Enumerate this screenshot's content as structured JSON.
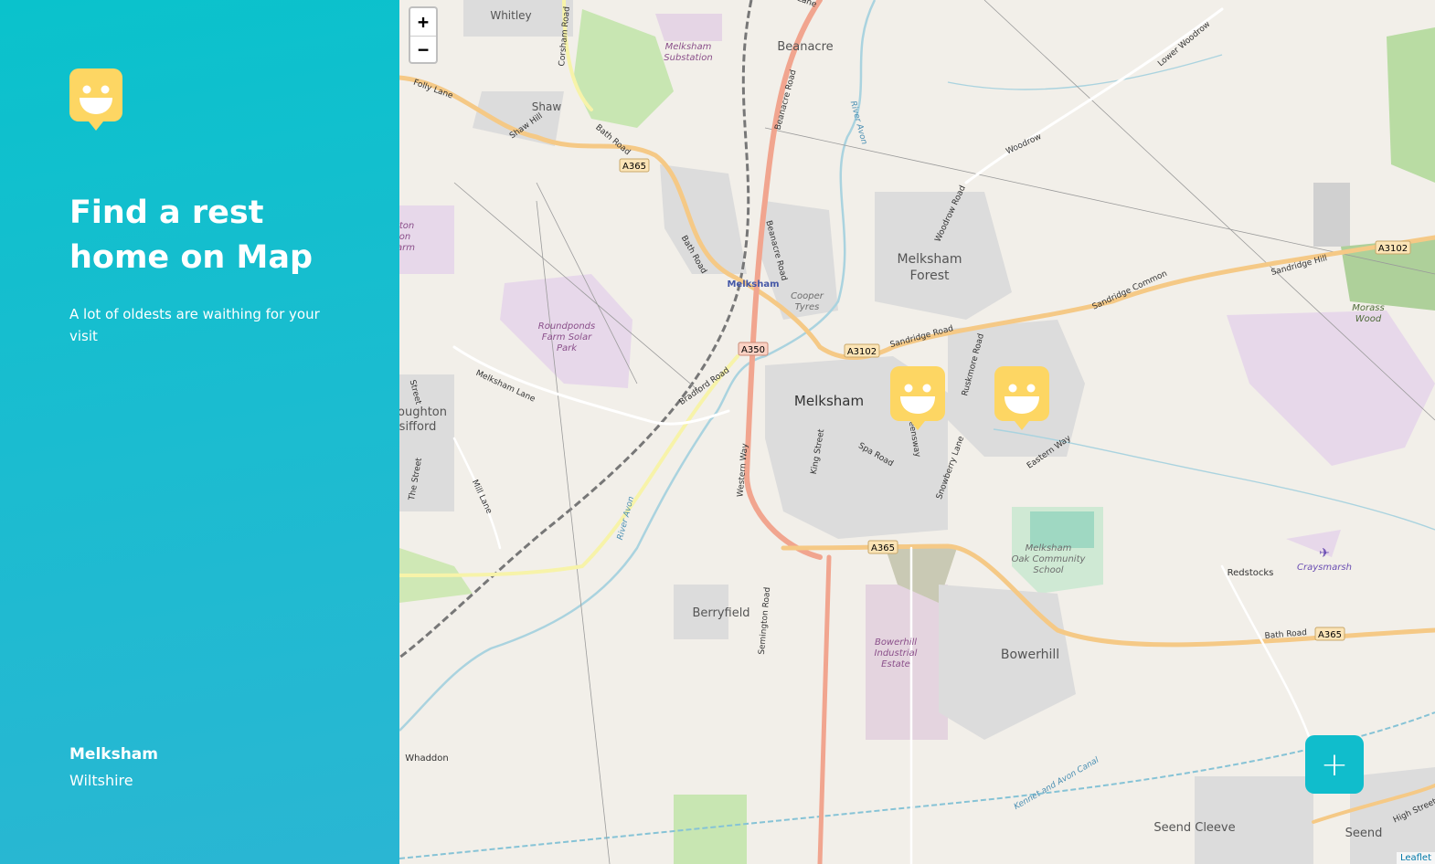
{
  "sidebar": {
    "logo_icon": "smiley-speech-bubble-icon",
    "title": "Find a rest home on Map",
    "subtitle": "A lot of oldests are waithing for your visit",
    "location": {
      "city": "Melksham",
      "region": "Wiltshire"
    }
  },
  "map": {
    "zoom_in_label": "+",
    "zoom_out_label": "−",
    "add_button_label": "+",
    "attribution": "Leaflet",
    "marker_icon": "smiley-speech-bubble-icon",
    "marker_count": 2,
    "colors": {
      "accent": "#10bdcc",
      "marker": "#fdd663",
      "sidebar_top": "#0ac2cc",
      "sidebar_bottom": "#2ab6d3"
    },
    "place_labels": {
      "melksham": "Melksham",
      "melksham_forest_1": "Melksham",
      "melksham_forest_2": "Forest",
      "bowerhill": "Bowerhill",
      "berryfield": "Berryfield",
      "beanacre": "Beanacre",
      "shaw": "Shaw",
      "whitley": "Whitley",
      "seend_cleeve": "Seend Cleeve",
      "seend": "Seend",
      "redstocks": "Redstocks",
      "whaddon": "Whaddon",
      "broughton_1": "oughton",
      "broughton_2": "sifford",
      "station": "Melksham",
      "substation_1": "Melksham",
      "substation_2": "Substation",
      "cooper_1": "Cooper",
      "cooper_2": "Tyres",
      "roundponds_1": "Roundponds",
      "roundponds_2": "Farm Solar",
      "roundponds_3": "Park",
      "bowerhill_ind_1": "Bowerhill",
      "bowerhill_ind_2": "Industrial",
      "bowerhill_ind_3": "Estate",
      "oak_school_1": "Melksham",
      "oak_school_2": "Oak Community",
      "oak_school_3": "School",
      "morass_1": "Morass",
      "morass_2": "Wood",
      "craysmarsh": "Craysmarsh",
      "left_edge_1": "ton",
      "left_edge_2": "on",
      "left_edge_3": "arm"
    },
    "road_labels": {
      "a365_nw": "A365",
      "a350": "A350",
      "a3102_c": "A3102",
      "a3102_e": "A3102",
      "a365_s": "A365",
      "a365_e": "A365",
      "bath_road_n": "Bath Road",
      "bath_road_2": "Bath Road",
      "bath_road_e": "Bath Road",
      "folly_lane": "Folly Lane",
      "shaw_hill": "Shaw Hill",
      "corsham_road": "Corsham Road",
      "beanacre_road_n": "Beanacre Road",
      "beanacre_road_s": "Beanacre Road",
      "river_avon_n": "River Avon",
      "river_avon_s": "River Avon",
      "melksham_lane": "Melksham Lane",
      "bradford_road": "Bradford Road",
      "western_way": "Western Way",
      "king_street": "King Street",
      "spa_road": "Spa Road",
      "snowberry_lane": "Snowberry Lane",
      "eastern_way": "Eastern Way",
      "sandridge_road": "Sandridge Road",
      "sandridge_common": "Sandridge Common",
      "sandridge_hill": "Sandridge Hill",
      "woodrow_road": "Woodrow Road",
      "woodrow": "Woodrow",
      "lower_woodrow": "Lower Woodrow",
      "mill_lane": "Mill Lane",
      "the_street": "The Street",
      "street": "Street",
      "semington_road": "Semington Road",
      "kennet_avon": "Kennet and Avon Canal",
      "queensway": "Queensway",
      "ruskmore_road": "Ruskmore Road",
      "high_street": "High Street",
      "lane_top": "Lane"
    }
  }
}
